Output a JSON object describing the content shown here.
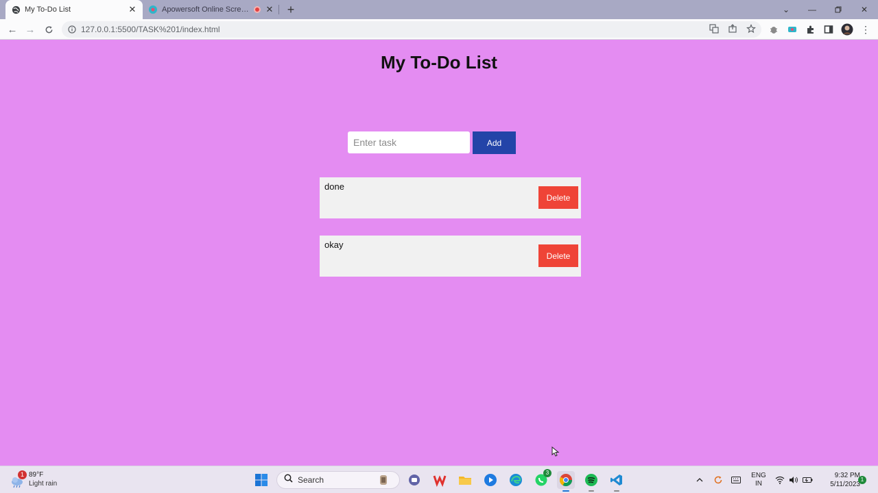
{
  "browser": {
    "tabs": [
      {
        "title": "My To-Do List",
        "active": true
      },
      {
        "title": "Apowersoft Online Screen Re",
        "active": false
      }
    ],
    "url": "127.0.0.1:5500/TASK%201/index.html"
  },
  "page": {
    "title": "My To-Do List",
    "input_placeholder": "Enter task",
    "input_value": "",
    "add_label": "Add",
    "tasks": [
      {
        "text": "done",
        "delete_label": "Delete"
      },
      {
        "text": "okay",
        "delete_label": "Delete"
      }
    ]
  },
  "colors": {
    "background": "#e48cf2",
    "add_button": "#2344a8",
    "delete_button": "#ef4437",
    "task_background": "#f1f1f1"
  },
  "taskbar": {
    "weather_temp": "89°F",
    "weather_desc": "Light rain",
    "weather_badge": "1",
    "search_label": "Search",
    "whatsapp_badge": "3",
    "lang_line1": "ENG",
    "lang_line2": "IN",
    "time": "9:32 PM",
    "date": "5/11/2023",
    "notification_count": "1"
  }
}
